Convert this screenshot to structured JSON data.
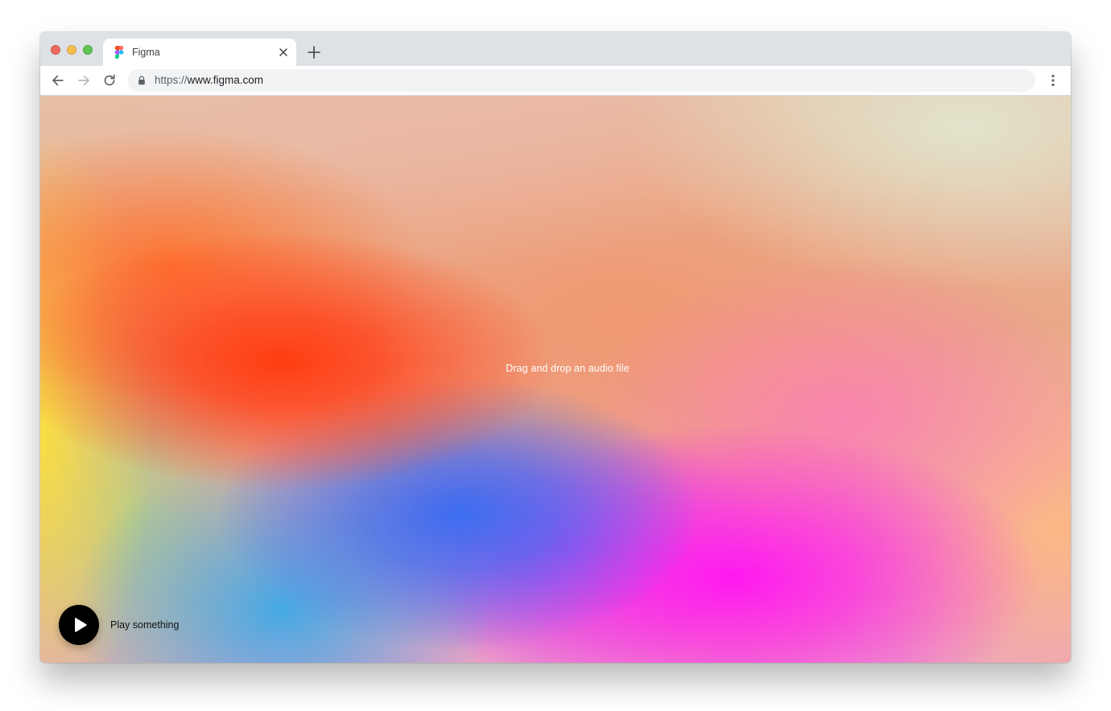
{
  "browser": {
    "tab": {
      "title": "Figma",
      "favicon": "figma-logo-icon",
      "close_icon": "close-icon"
    },
    "new_tab_icon": "plus-icon",
    "nav": {
      "back_icon": "arrow-left-icon",
      "forward_icon": "arrow-right-icon",
      "reload_icon": "reload-icon"
    },
    "address_bar": {
      "scheme": "https://",
      "host": "www.figma.com",
      "lock_icon": "lock-icon"
    },
    "menu_icon": "more-vertical-icon",
    "colors": {
      "tabstrip": "#dee1e6",
      "omnibox": "#f1f3f4",
      "traffic_close": "#ed6a5e",
      "traffic_minimize": "#f5bf4f",
      "traffic_maximize": "#61c554"
    }
  },
  "page": {
    "drop_hint": "Drag and drop an audio file",
    "player": {
      "play_icon": "play-icon",
      "label": "Play something"
    },
    "gradient_colors": [
      "#ff3d12",
      "#3c6df0",
      "#ff18f0",
      "#fae13c",
      "#afcd8c",
      "#ffb982",
      "#e1e6cd"
    ]
  }
}
